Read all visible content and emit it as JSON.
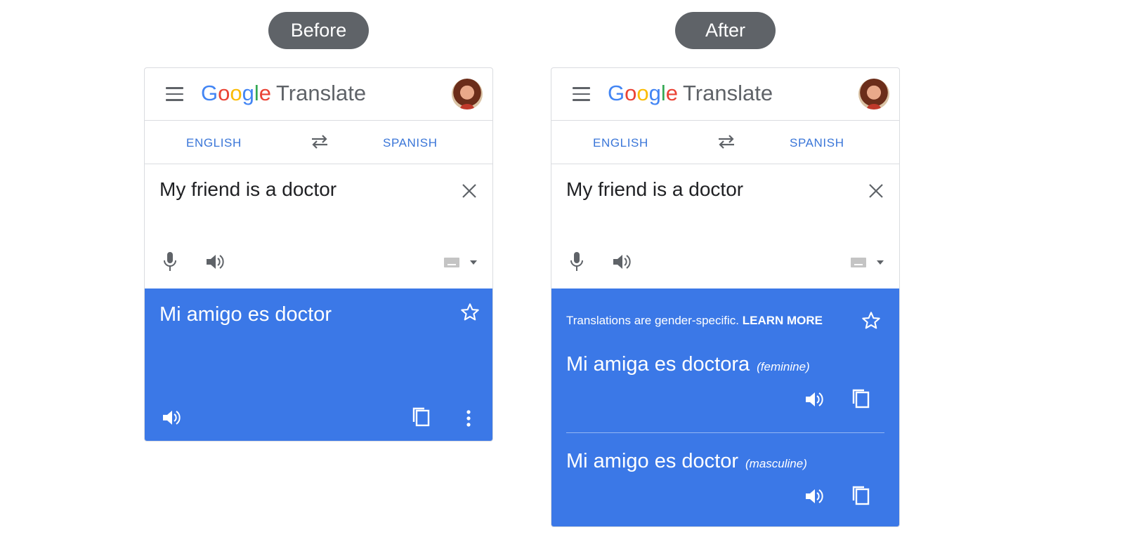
{
  "labels": {
    "before": "Before",
    "after": "After"
  },
  "app": {
    "logo_letters": [
      "G",
      "o",
      "o",
      "g",
      "l",
      "e"
    ],
    "product": "Translate"
  },
  "languages": {
    "source": "ENGLISH",
    "target": "SPANISH"
  },
  "input": {
    "text": "My friend is a doctor"
  },
  "before_result": {
    "translation": "Mi amigo es doctor"
  },
  "after_result": {
    "notice": "Translations are gender-specific.",
    "learn_more": "LEARN MORE",
    "feminine": {
      "translation": "Mi amiga es doctora",
      "tag": "(feminine)"
    },
    "masculine": {
      "translation": "Mi amigo es doctor",
      "tag": "(masculine)"
    }
  },
  "colors": {
    "accent": "#3b78e7",
    "label_pill": "#5f6368",
    "link_blue": "#3a76d8"
  },
  "icons": [
    "menu-icon",
    "swap-icon",
    "close-icon",
    "mic-icon",
    "speaker-icon",
    "keyboard-icon",
    "dropdown-arrow-icon",
    "star-icon",
    "copy-icon",
    "more-vert-icon"
  ]
}
